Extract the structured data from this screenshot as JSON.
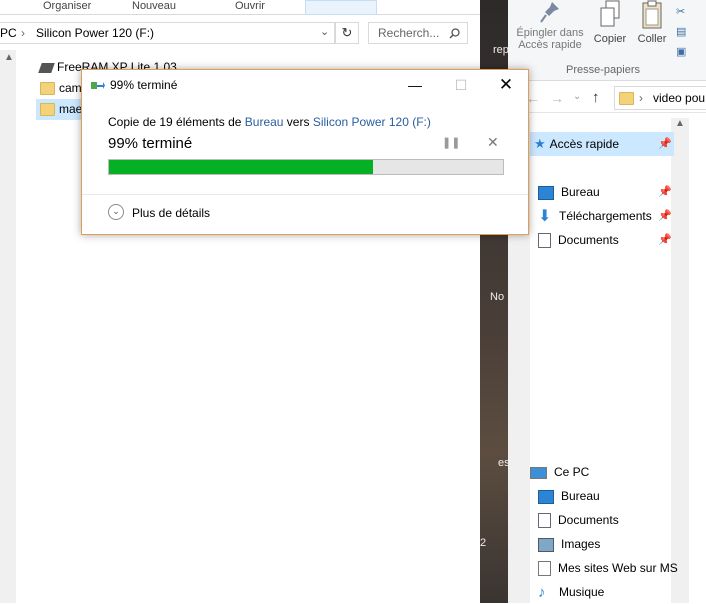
{
  "left_explorer": {
    "ribbon": [
      "Organiser",
      "Nouveau",
      "Ouvrir"
    ],
    "path_prefix": "PC",
    "drive": "Silicon Power 120  (F:)",
    "search_placeholder": "Recherch...",
    "items": [
      "FreeRAM XP Lite 1.03",
      "cam",
      "mae"
    ]
  },
  "desktop_fragments": [
    "rep",
    "No",
    "es",
    "2"
  ],
  "right_explorer": {
    "ribbon_buttons": [
      "Épingler dans\nAccès rapide",
      "Copier",
      "Coller"
    ],
    "ribbon_group": "Presse-papiers",
    "path": "video pou",
    "quick_access": "Accès rapide",
    "quick_items": [
      {
        "label": "Bureau",
        "icon": "desktop-icon"
      },
      {
        "label": "Téléchargements",
        "icon": "download-icon"
      },
      {
        "label": "Documents",
        "icon": "documents-icon"
      }
    ],
    "this_pc": "Ce PC",
    "pc_items": [
      {
        "label": "Bureau",
        "icon": "desktop-icon"
      },
      {
        "label": "Documents",
        "icon": "documents-icon"
      },
      {
        "label": "Images",
        "icon": "images-icon"
      },
      {
        "label": "Mes sites Web sur MS",
        "icon": "web-icon"
      },
      {
        "label": "Musique",
        "icon": "music-icon"
      }
    ]
  },
  "dialog": {
    "title": "99% terminé",
    "desc_prefix": "Copie de 19 éléments de ",
    "source": "Bureau",
    "middle": " vers ",
    "destination": "Silicon Power 120  (F:)",
    "progress_text": "99% terminé",
    "progress_fraction": 0.67,
    "more_details": "Plus de détails",
    "bar_color": "#06b025"
  }
}
